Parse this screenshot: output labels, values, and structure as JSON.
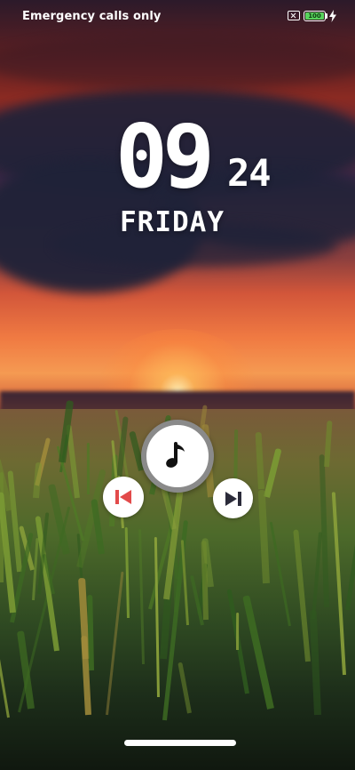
{
  "status_bar": {
    "carrier_text": "Emergency calls only",
    "battery_level": "100",
    "battery_color": "#58d35c",
    "sim_icon": "no-sim-icon",
    "charging_icon": "lightning-bolt-icon"
  },
  "clock": {
    "hour": "09",
    "minute": "24",
    "weekday": "FRIDAY"
  },
  "music_widget": {
    "main_icon": "music-note-icon",
    "prev_icon": "skip-previous-icon",
    "next_icon": "skip-next-icon",
    "ring_color": "#8a8a8a",
    "button_color": "#ffffff"
  },
  "wallpaper": {
    "description_colors": {
      "sky_top": "#2c1a2a",
      "sunset_orange": "#f07a42",
      "cloud": "#1f2238",
      "field_dark": "#10180f"
    }
  }
}
